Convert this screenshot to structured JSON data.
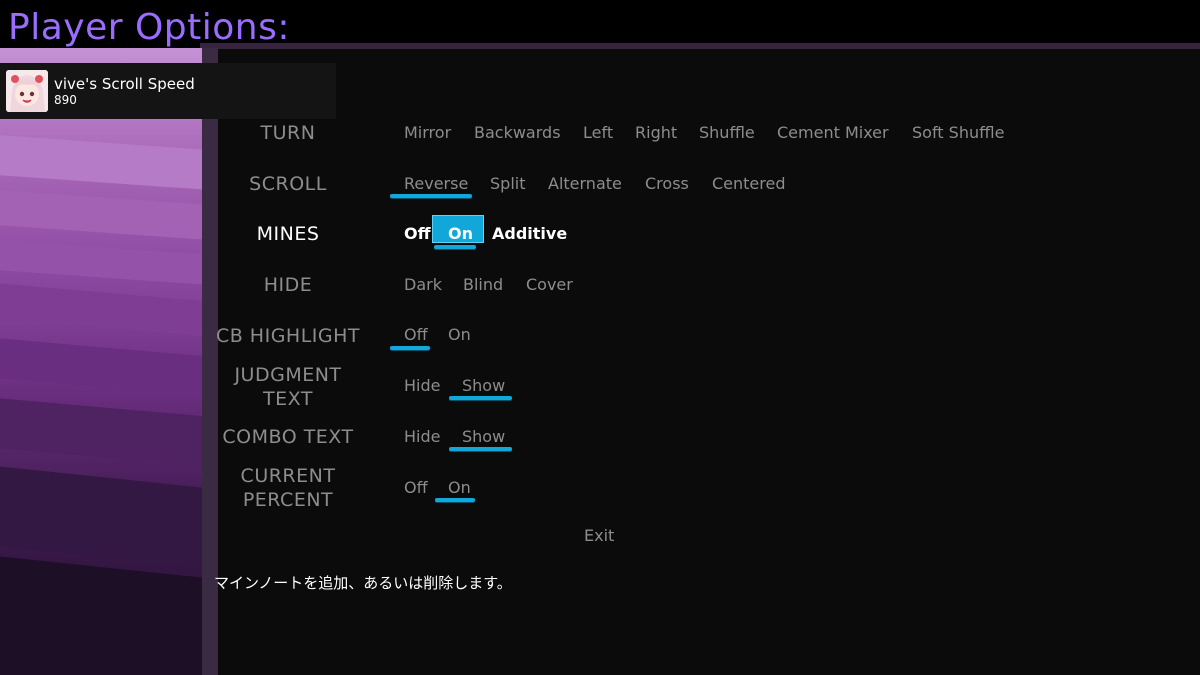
{
  "header": {
    "title": "Player Options:"
  },
  "player": {
    "name": "vive's Scroll Speed",
    "speed": "890",
    "avatar_icon": "anime-avatar-icon"
  },
  "rows": [
    {
      "label": "TURN",
      "options": [
        "Mirror",
        "Backwards",
        "Left",
        "Right",
        "Shuffle",
        "Cement Mixer",
        "Soft Shuffle"
      ],
      "selected": []
    },
    {
      "label": "SCROLL",
      "options": [
        "Reverse",
        "Split",
        "Alternate",
        "Cross",
        "Centered"
      ],
      "selected": [
        "Reverse"
      ]
    },
    {
      "label": "MINES",
      "options": [
        "Off",
        "On",
        "Additive"
      ],
      "selected": [
        "On"
      ],
      "focused": true,
      "cursor": "On"
    },
    {
      "label": "HIDE",
      "options": [
        "Dark",
        "Blind",
        "Cover"
      ],
      "selected": []
    },
    {
      "label": "CB HIGHLIGHT",
      "options": [
        "Off",
        "On"
      ],
      "selected": [
        "Off"
      ]
    },
    {
      "label_lines": [
        "JUDGMENT",
        "TEXT"
      ],
      "options": [
        "Hide",
        "Show"
      ],
      "selected": [
        "Show"
      ]
    },
    {
      "label": "COMBO TEXT",
      "options": [
        "Hide",
        "Show"
      ],
      "selected": [
        "Show"
      ]
    },
    {
      "label_lines": [
        "CURRENT",
        "PERCENT"
      ],
      "options": [
        "Off",
        "On"
      ],
      "selected": [
        "On"
      ]
    }
  ],
  "exit_label": "Exit",
  "description": "マインノートを追加、あるいは削除します。",
  "colors": {
    "accent": "#12a7d9",
    "title": "#9a6dff",
    "inactive_text": "#8d8d8d",
    "active_text": "#ffffff"
  }
}
